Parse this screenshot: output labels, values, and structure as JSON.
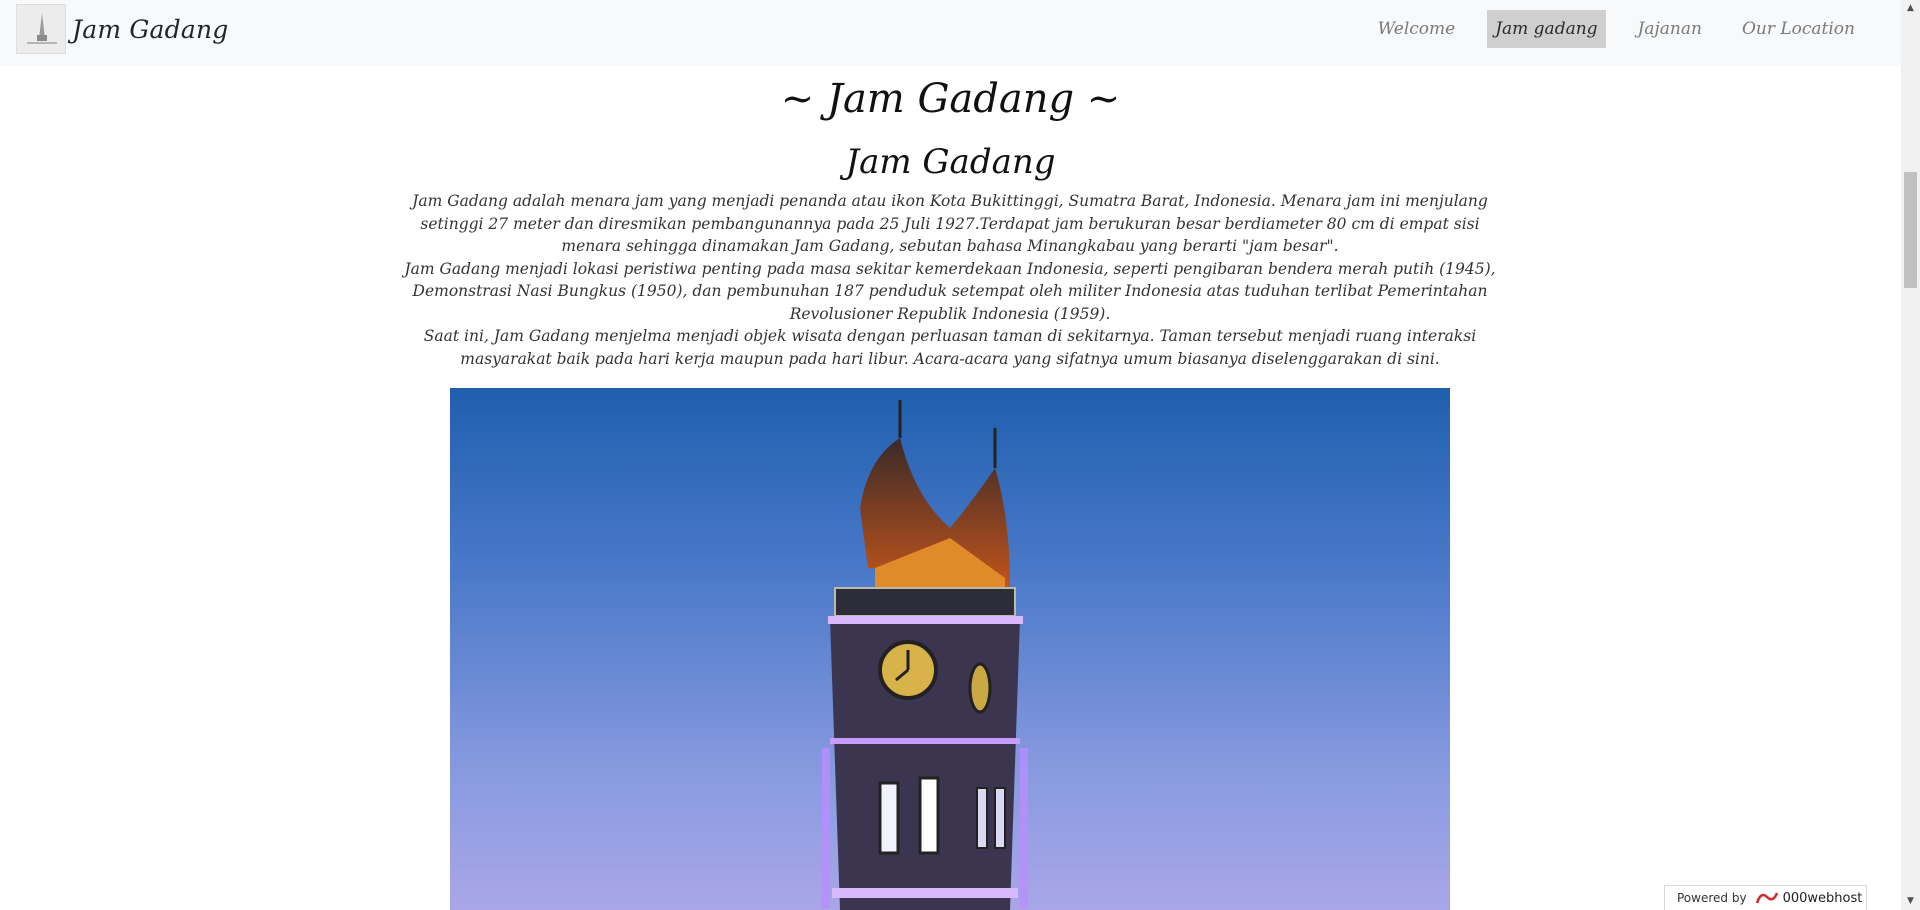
{
  "navbar": {
    "brand": "Jam Gadang",
    "logo_icon": "tower-logo-icon",
    "items": [
      {
        "label": "Welcome",
        "active": false
      },
      {
        "label": "Jam gadang",
        "active": true
      },
      {
        "label": "Jajanan",
        "active": false
      },
      {
        "label": "Our Location",
        "active": false
      }
    ]
  },
  "main": {
    "title": "~ Jam Gadang ~",
    "subtitle": "Jam Gadang",
    "paragraphs": [
      "Jam Gadang adalah menara jam yang menjadi penanda atau ikon Kota Bukittinggi, Sumatra Barat, Indonesia. Menara jam ini menjulang setinggi 27 meter dan diresmikan pembangunannya pada 25 Juli 1927.Terdapat jam berukuran besar berdiameter 80 cm di empat sisi menara sehingga dinamakan Jam Gadang, sebutan bahasa Minangkabau yang berarti \"jam besar\".",
      "Jam Gadang menjadi lokasi peristiwa penting pada masa sekitar kemerdekaan Indonesia, seperti pengibaran bendera merah putih (1945), Demonstrasi Nasi Bungkus (1950), dan pembunuhan 187 penduduk setempat oleh militer Indonesia atas tuduhan terlibat Pemerintahan Revolusioner Republik Indonesia (1959).",
      "Saat ini, Jam Gadang menjelma menjadi objek wisata dengan perluasan taman di sekitarnya. Taman tersebut menjadi ruang interaksi masyarakat baik pada hari kerja maupun pada hari libur. Acara-acara yang sifatnya umum biasanya diselenggarakan di sini."
    ],
    "image": "jam-gadang-tower-photo"
  },
  "badge": {
    "prefix": "Powered by",
    "host": "000webhost"
  },
  "colors": {
    "navbar_bg": "#f8f9fa",
    "active_nav_bg": "#cfcfcf",
    "sky_top": "#1f5fae",
    "tower_glow": "#b98cff"
  }
}
